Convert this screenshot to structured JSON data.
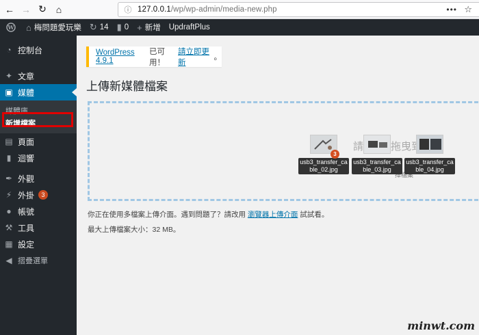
{
  "browser": {
    "url_host": "127.0.0.1",
    "url_path": "/wp/wp-admin/media-new.php"
  },
  "adminbar": {
    "site_name": "梅問題愛玩樂",
    "updates_count": "14",
    "comments_count": "0",
    "new_label": "新增",
    "plugin_label": "UpdraftPlus"
  },
  "sidebar": {
    "dashboard": "控制台",
    "posts": "文章",
    "media": "媒體",
    "media_library": "媒體庫",
    "add_new": "新增檔案",
    "pages": "頁面",
    "comments": "迴響",
    "appearance": "外觀",
    "plugins": "外掛",
    "plugins_badge": "3",
    "users": "帳號",
    "tools": "工具",
    "settings": "設定",
    "collapse": "摺疊選單"
  },
  "notice": {
    "version_link": "WordPress 4.9.1",
    "available": " 已可用！",
    "update_link": "請立即更新",
    "end": "。"
  },
  "page_title": "上傳新媒體檔案",
  "dropzone": {
    "drop_text_1": "請",
    "drop_text_2": "拖曳到",
    "or_text": "或",
    "select_text": "擇檔案",
    "count": "3",
    "files": [
      {
        "name_line1": "usb3_transfer_ca",
        "name_line2": "ble_02.jpg"
      },
      {
        "name_line1": "usb3_transfer_ca",
        "name_line2": "ble_03.jpg"
      },
      {
        "name_line1": "usb3_transfer_ca",
        "name_line2": "ble_04.jpg"
      }
    ]
  },
  "info": {
    "text": "你正在使用多檔案上傳介面。遇到問題了？請改用 ",
    "link": "瀏覽器上傳介面",
    "tail": " 試試看。"
  },
  "max_upload": "最大上傳檔案大小：32 MB。",
  "watermark": "minwt.com",
  "colors": {
    "admin_dark": "#23282d",
    "accent_blue": "#0073aa",
    "highlight_red": "#e00000",
    "notice_yellow": "#ffb900"
  }
}
